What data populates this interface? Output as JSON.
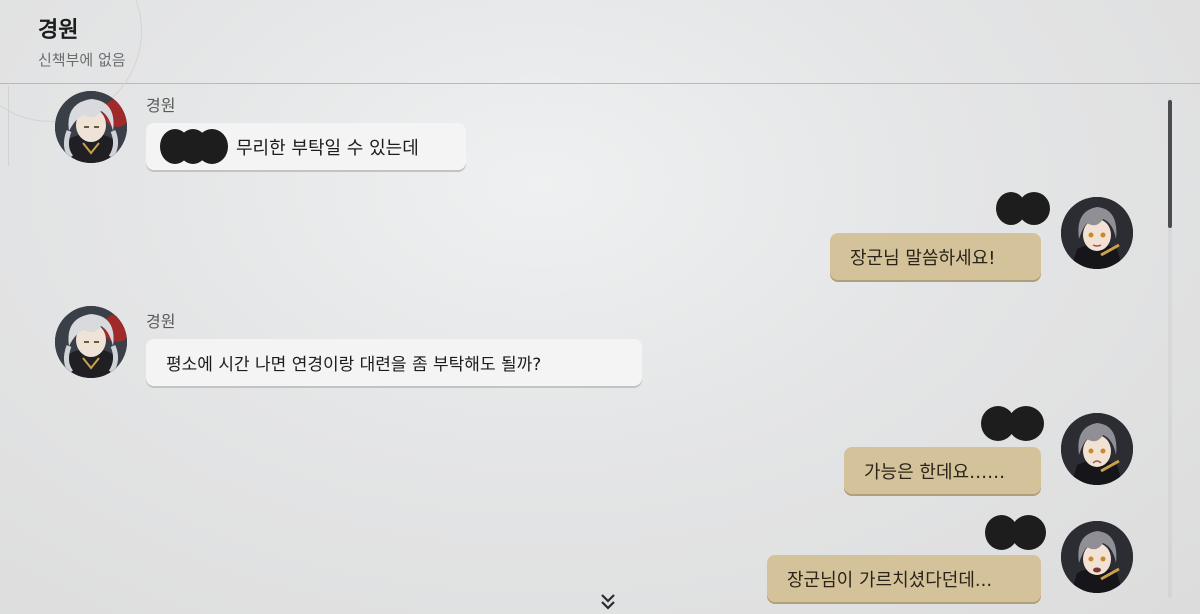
{
  "header": {
    "title": "경원",
    "status": "신책부에 없음"
  },
  "messages": [
    {
      "side": "in",
      "sender": "경원",
      "text": "무리한 부탁일 수 있는데"
    },
    {
      "side": "out",
      "text": "장군님 말씀하세요!"
    },
    {
      "side": "in",
      "sender": "경원",
      "text": "평소에 시간 나면 연경이랑 대련을 좀 부탁해도 될까?"
    },
    {
      "side": "out",
      "text": "가능은 한데요……"
    },
    {
      "side": "out",
      "text": "장군님이 가르치셨다던데..."
    }
  ],
  "icons": {
    "scroll_down": "double-chevron-down-icon"
  },
  "colors": {
    "incoming_bubble": "#f4f4f4",
    "outgoing_bubble": "#d4c29b",
    "redaction": "#1d1d1d"
  }
}
